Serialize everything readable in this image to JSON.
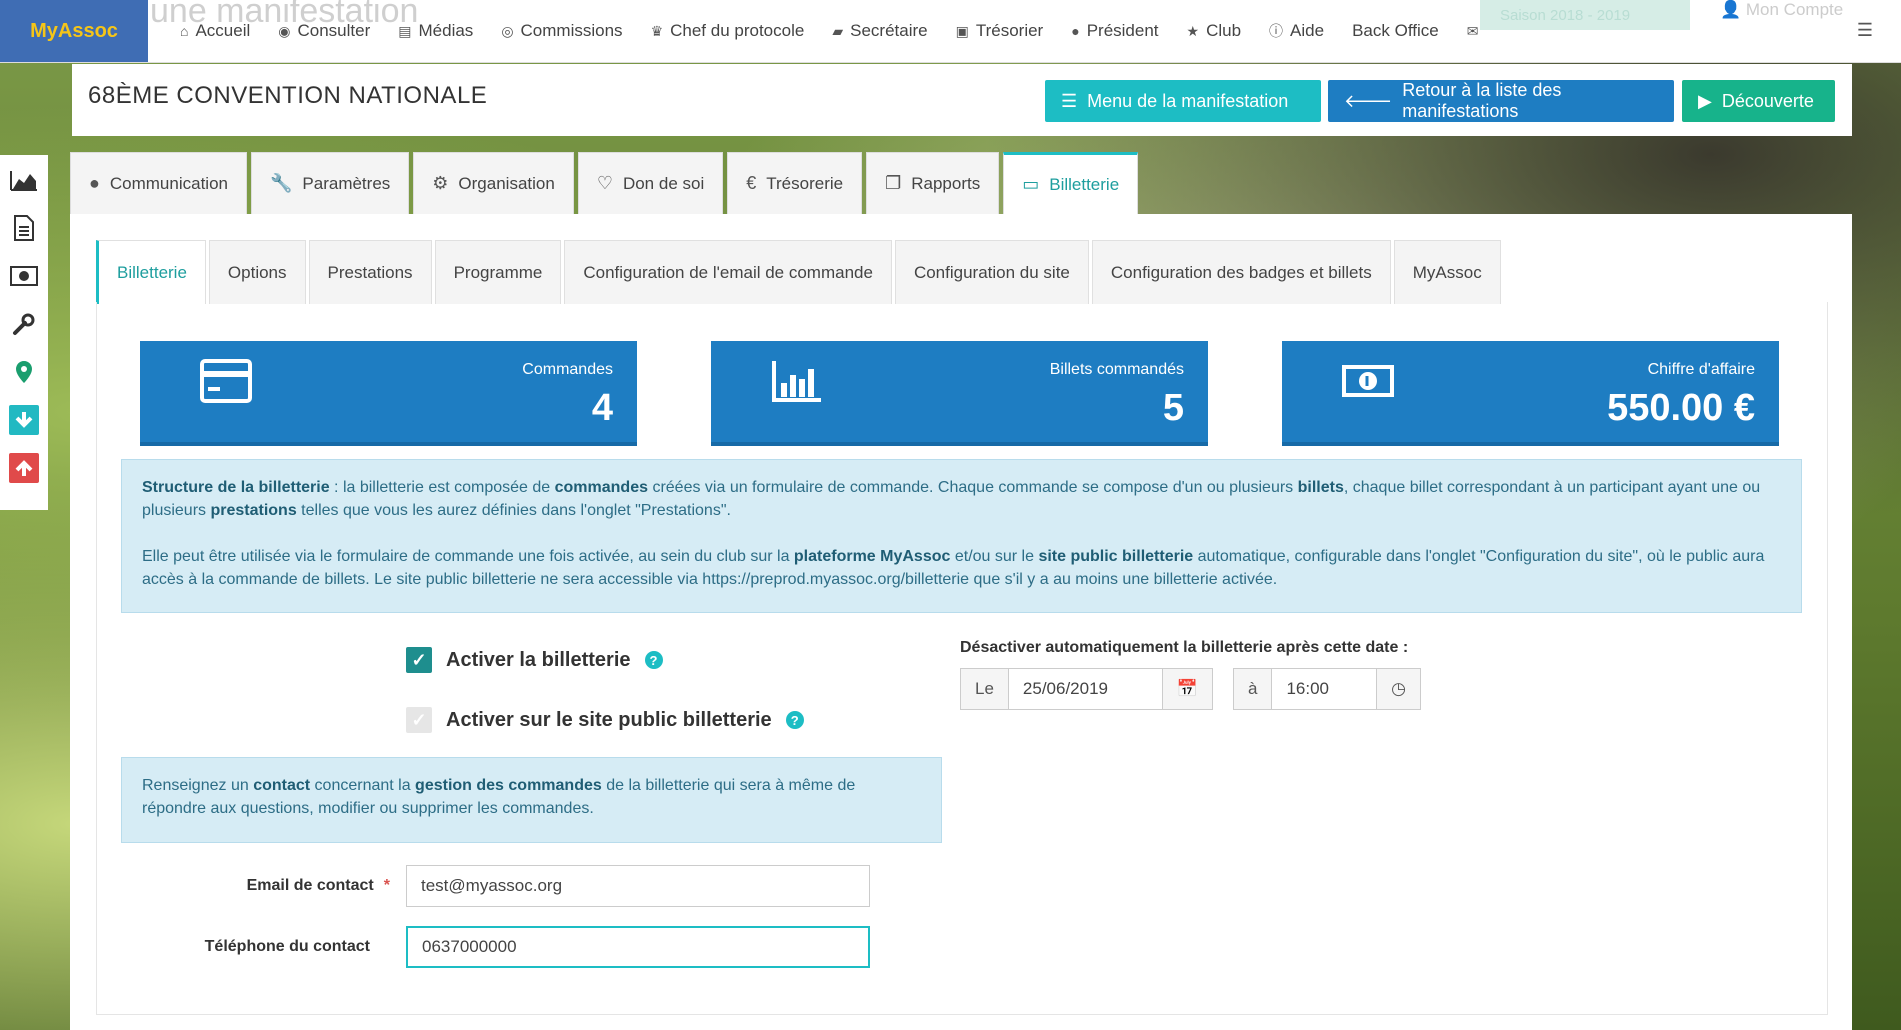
{
  "app": {
    "brand": "MyAssoc",
    "ghost_title": "une manifestation"
  },
  "topnav": {
    "items": [
      {
        "label": "Accueil",
        "icon": "home-icon"
      },
      {
        "label": "Consulter",
        "icon": "eye-icon"
      },
      {
        "label": "Médias",
        "icon": "file-icon"
      },
      {
        "label": "Commissions",
        "icon": "user-circle-icon"
      },
      {
        "label": "Chef du protocole",
        "icon": "trophy-icon"
      },
      {
        "label": "Secrétaire",
        "icon": "book-icon"
      },
      {
        "label": "Trésorier",
        "icon": "money-icon"
      },
      {
        "label": "Président",
        "icon": "globe-icon"
      },
      {
        "label": "Club",
        "icon": "star-icon"
      },
      {
        "label": "Aide",
        "icon": "info-icon"
      },
      {
        "label": "Back Office",
        "icon": ""
      }
    ],
    "season": "Saison 2018 - 2019",
    "account": "Mon Compte"
  },
  "header": {
    "title": "68ÈME CONVENTION NATIONALE",
    "btn_menu": "Menu de la manifestation",
    "btn_back": "Retour à la liste des manifestations",
    "btn_discover": "Découverte"
  },
  "main_tabs": [
    {
      "label": "Communication"
    },
    {
      "label": "Paramètres"
    },
    {
      "label": "Organisation"
    },
    {
      "label": "Don de soi"
    },
    {
      "label": "Trésorerie"
    },
    {
      "label": "Rapports"
    },
    {
      "label": "Billetterie"
    }
  ],
  "sub_tabs": [
    {
      "label": "Billetterie"
    },
    {
      "label": "Options"
    },
    {
      "label": "Prestations"
    },
    {
      "label": "Programme"
    },
    {
      "label": "Configuration de l'email de commande"
    },
    {
      "label": "Configuration du site"
    },
    {
      "label": "Configuration des badges et billets"
    },
    {
      "label": "MyAssoc"
    }
  ],
  "stats": [
    {
      "label": "Commandes",
      "value": "4"
    },
    {
      "label": "Billets commandés",
      "value": "5"
    },
    {
      "label": "Chiffre d'affaire",
      "value": "550.00 €"
    }
  ],
  "info1": {
    "p1_b1": "Structure de la billetterie",
    "p1_t1": " : la billetterie est composée de ",
    "p1_b2": "commandes",
    "p1_t2": " créées via un formulaire de commande. Chaque commande se compose d'un ou plusieurs ",
    "p1_b3": "billets",
    "p1_t3": ", chaque billet correspondant à un participant ayant une ou plusieurs ",
    "p1_b4": "prestations",
    "p1_t4": " telles que vous les aurez définies dans l'onglet \"Prestations\".",
    "p2_t1": "Elle peut être utilisée via le formulaire de commande une fois activée, au sein du club sur la ",
    "p2_b1": "plateforme MyAssoc",
    "p2_t2": " et/ou sur le ",
    "p2_b2": "site public billetterie",
    "p2_t3": " automatique, configurable dans l'onglet \"Configuration du site\", où le public aura accès à la commande de billets. Le site public billetterie ne sera accessible via https://preprod.myassoc.org/billetterie que s'il y a au moins une billetterie activée."
  },
  "checks": {
    "activate": "Activer la billetterie",
    "activate_public": "Activer sur le site public billetterie"
  },
  "deactivate": {
    "label": "Désactiver automatiquement la billetterie après cette date :",
    "prefix": "Le",
    "date": "25/06/2019",
    "at": "à",
    "time": "16:00"
  },
  "info2": {
    "t1": "Renseignez un ",
    "b1": "contact",
    "t2": " concernant la ",
    "b2": "gestion des commandes",
    "t3": " de la billetterie qui sera à même de répondre aux questions, modifier ou supprimer les commandes."
  },
  "contact": {
    "email_label": "Email de contact",
    "email_value": "test@myassoc.org",
    "phone_label": "Téléphone du contact",
    "phone_value": "0637000000"
  },
  "colors": {
    "primary": "#1e7dc2",
    "accent": "#1dbdc4",
    "success": "#17b38b",
    "brand_bg": "#3f6db4",
    "brand_text": "#f5c518"
  }
}
